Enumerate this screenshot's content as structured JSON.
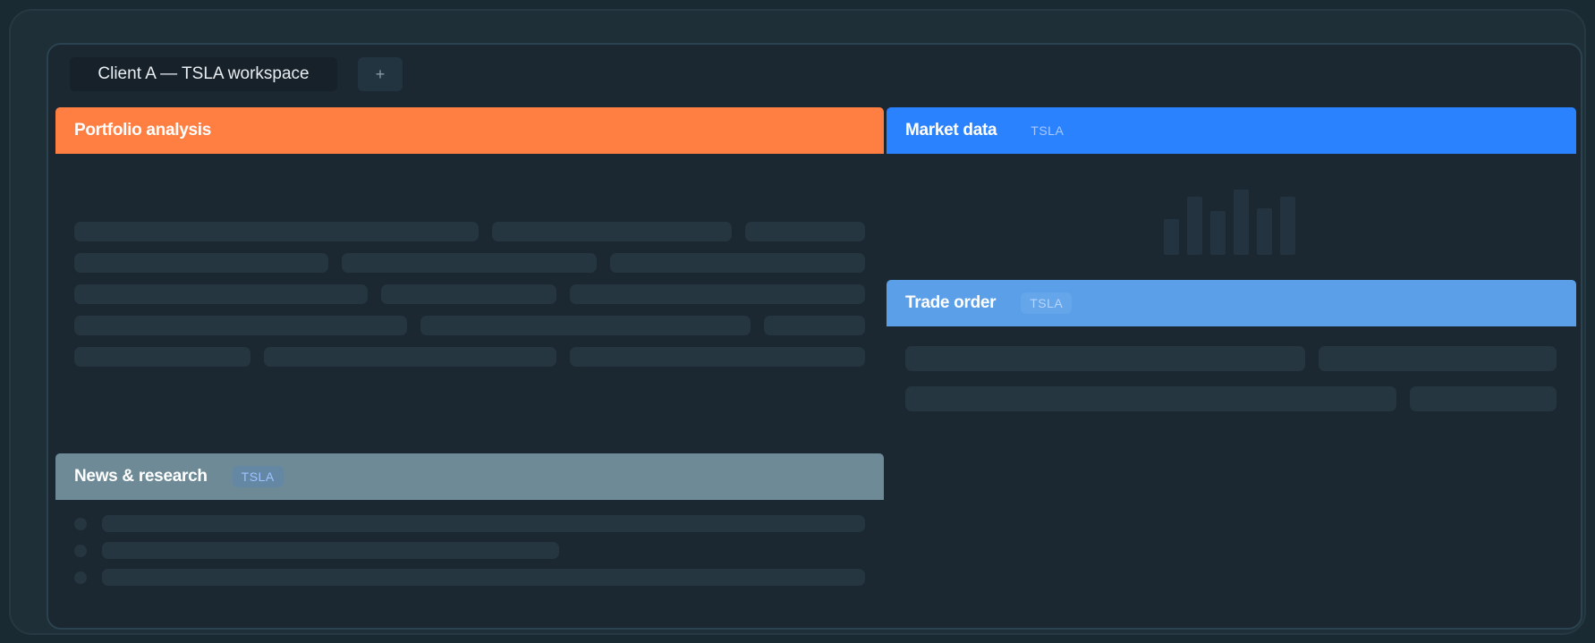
{
  "workspace": {
    "tabs": [
      {
        "label": "Client A — TSLA workspace"
      },
      {
        "label": "+"
      }
    ]
  },
  "panels": {
    "portfolio": {
      "title": "Portfolio analysis"
    },
    "market": {
      "title": "Market data",
      "badge": "TSLA"
    },
    "trade": {
      "title": "Trade order",
      "badge": "TSLA"
    },
    "news": {
      "title": "News & research",
      "badge": "TSLA"
    }
  },
  "market_chart_icon": "bar-chart-icon",
  "colors": {
    "portfolio_accent": "#ff7f43",
    "market_accent": "#2b82ff",
    "trade_accent": "#5a9fe8",
    "news_accent": "#6d8a96"
  }
}
